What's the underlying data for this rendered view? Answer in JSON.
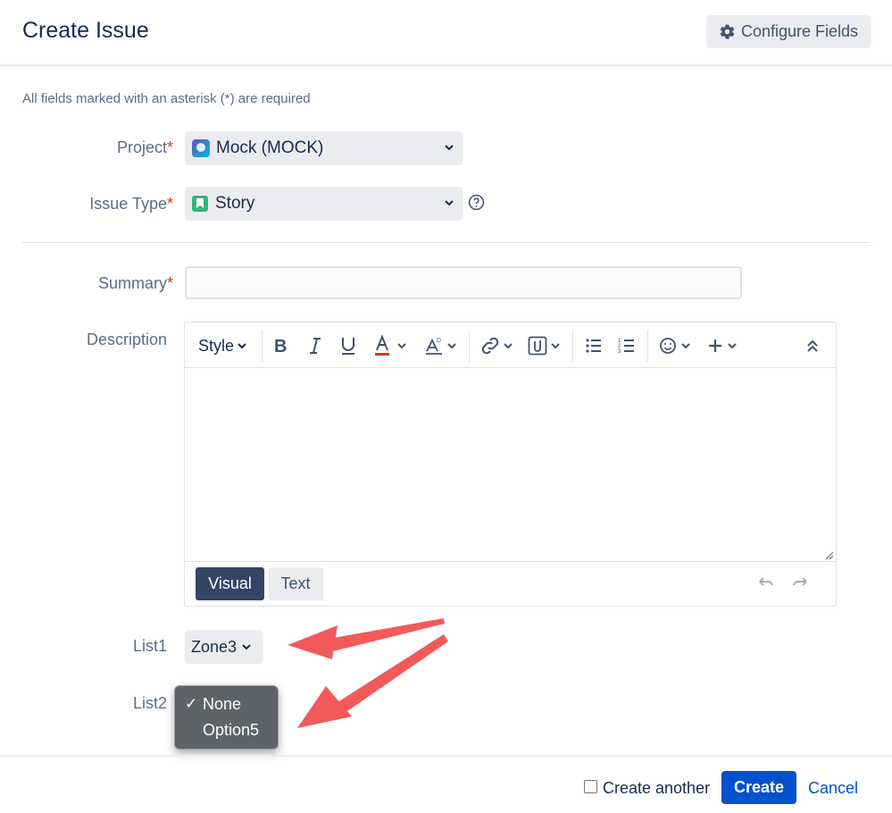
{
  "header": {
    "title": "Create Issue",
    "configure_label": "Configure Fields"
  },
  "form": {
    "required_note": "All fields marked with an asterisk (*) are required",
    "project": {
      "label": "Project",
      "value": "Mock (MOCK)"
    },
    "issue_type": {
      "label": "Issue Type",
      "value": "Story"
    },
    "summary": {
      "label": "Summary",
      "value": "",
      "placeholder": ""
    },
    "description": {
      "label": "Description",
      "style_label": "Style",
      "modes": [
        "Visual",
        "Text"
      ],
      "active_mode": "Visual"
    },
    "list1": {
      "label": "List1",
      "value": "Zone3"
    },
    "list2": {
      "label": "List2",
      "options": [
        "None",
        "Option5"
      ],
      "selected": "None"
    }
  },
  "footer": {
    "create_another_label": "Create another",
    "create_label": "Create",
    "cancel_label": "Cancel"
  },
  "colors": {
    "primary": "#0052cc",
    "required": "#de350b",
    "annotation_arrow": "#f25a5a"
  }
}
